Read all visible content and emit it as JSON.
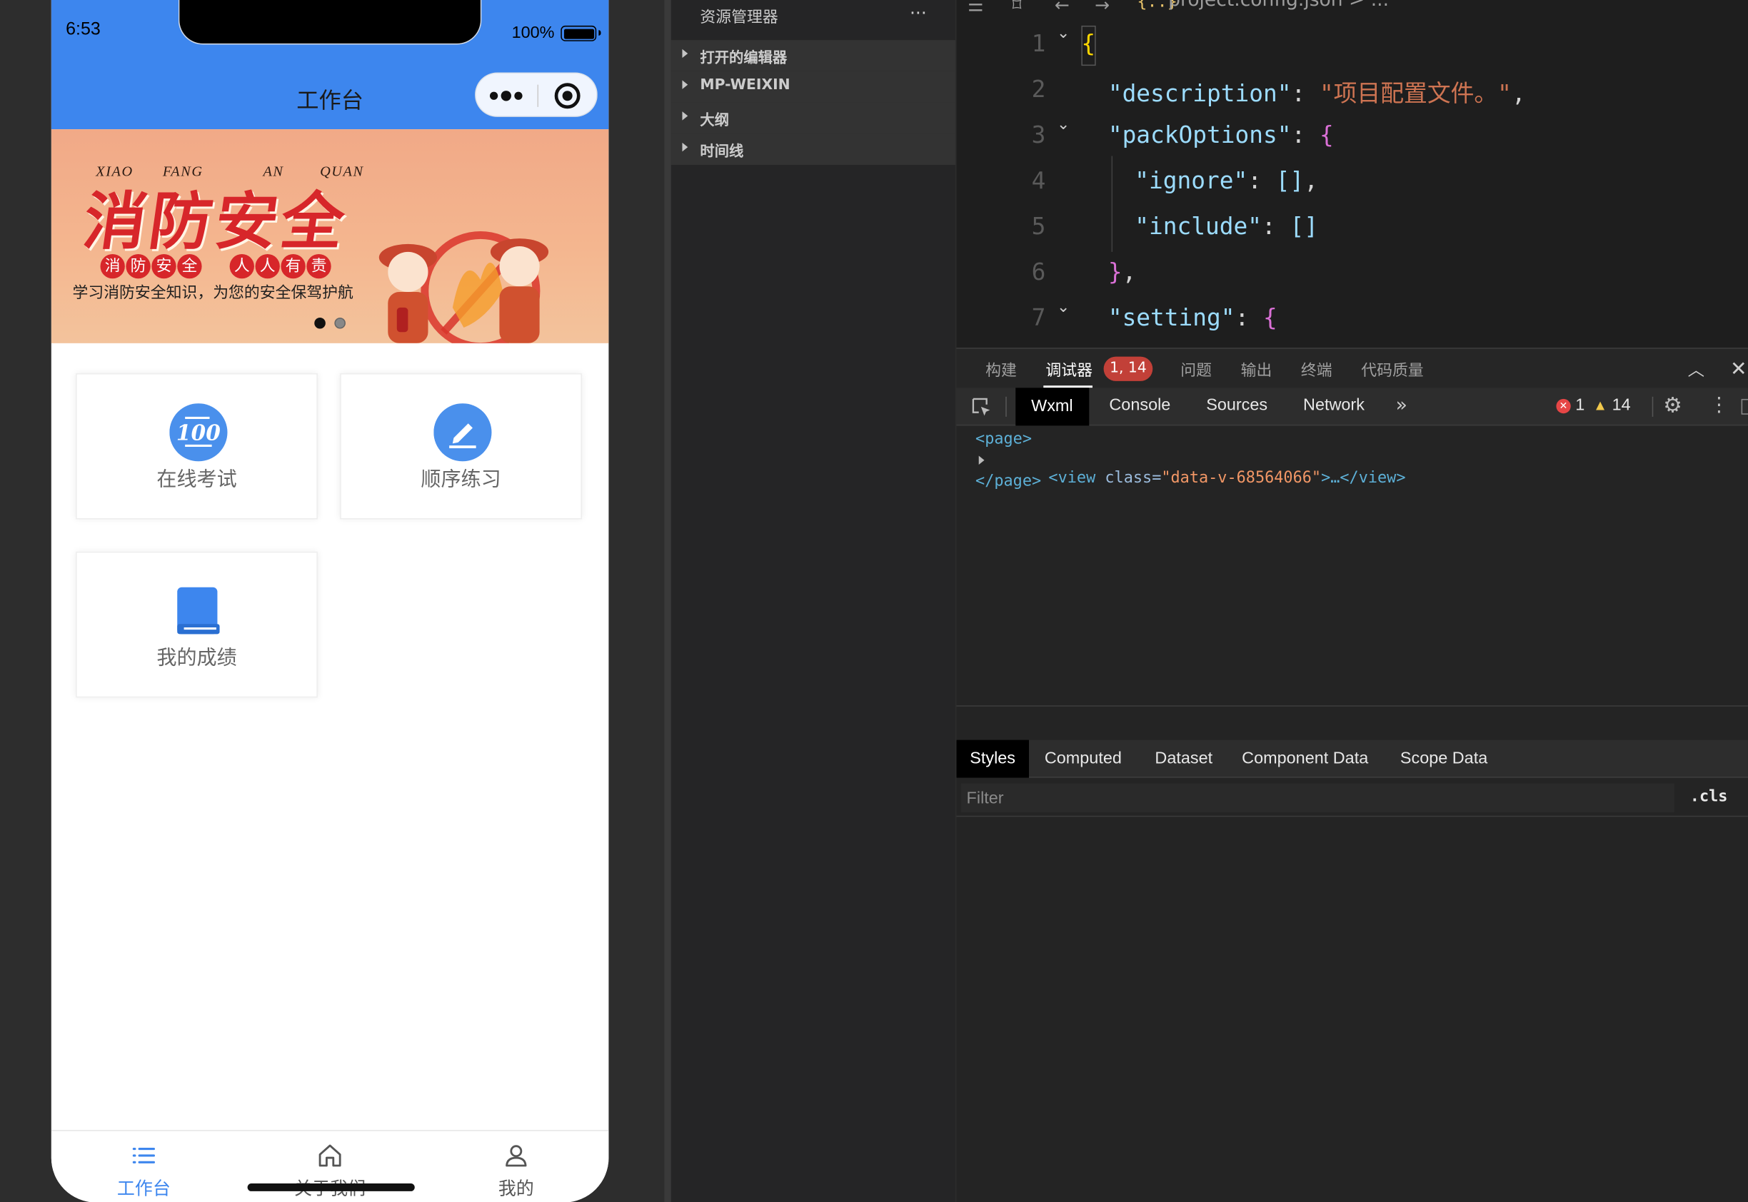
{
  "phone": {
    "status_time": "6:53",
    "battery_text": "100%",
    "nav_title": "工作台",
    "banner": {
      "pinyin": [
        "XIAO",
        "FANG",
        "AN",
        "QUAN"
      ],
      "headline": "消防安全",
      "slogan_left": [
        "消",
        "防",
        "安",
        "全"
      ],
      "slogan_right": [
        "人",
        "人",
        "有",
        "责"
      ],
      "subtitle": "学习消防安全知识，为您的安全保驾护航",
      "slide_index": 1,
      "slide_count": 2
    },
    "cards": [
      {
        "label": "在线考试",
        "icon": "exam-100-icon"
      },
      {
        "label": "顺序练习",
        "icon": "pen-edit-icon"
      },
      {
        "label": "我的成绩",
        "icon": "book-icon"
      }
    ],
    "tabbar": [
      {
        "label": "工作台",
        "icon": "list-icon",
        "active": true
      },
      {
        "label": "关于我们",
        "icon": "home-icon",
        "active": false
      },
      {
        "label": "我的",
        "icon": "user-icon",
        "active": false
      }
    ]
  },
  "explorer": {
    "title": "资源管理器",
    "more": "···",
    "sections": [
      "打开的编辑器",
      "MP-WEIXIN",
      "大纲",
      "时间线"
    ]
  },
  "editor": {
    "breadcrumb_icon": "{..}",
    "breadcrumb_file": "project.config.json",
    "breadcrumb_more": "> ...",
    "line_numbers": [
      "1",
      "2",
      "3",
      "4",
      "5",
      "6",
      "7"
    ],
    "lines": [
      "{",
      "\"description\": \"项目配置文件。\",",
      "\"packOptions\": {",
      "\"ignore\": [],",
      "\"include\": []",
      "},",
      "\"setting\": {"
    ]
  },
  "devtools": {
    "panel_tabs": [
      "构建",
      "调试器",
      "问题",
      "输出",
      "终端",
      "代码质量"
    ],
    "active_panel": "调试器",
    "badge": "1, 14",
    "chrome_tabs": [
      "Wxml",
      "Console",
      "Sources",
      "Network"
    ],
    "more_tabs": "»",
    "errors": "1",
    "warnings": "14",
    "dom": {
      "line1": "<page>",
      "line2_open": "<view ",
      "line2_attr": "class=",
      "line2_val": "\"data-v-68564066\"",
      "line2_close": ">…</view>",
      "line3": "</page>"
    },
    "style_tabs": [
      "Styles",
      "Computed",
      "Dataset",
      "Component Data",
      "Scope Data"
    ],
    "filter_placeholder": "Filter",
    "cls_label": ".cls"
  }
}
